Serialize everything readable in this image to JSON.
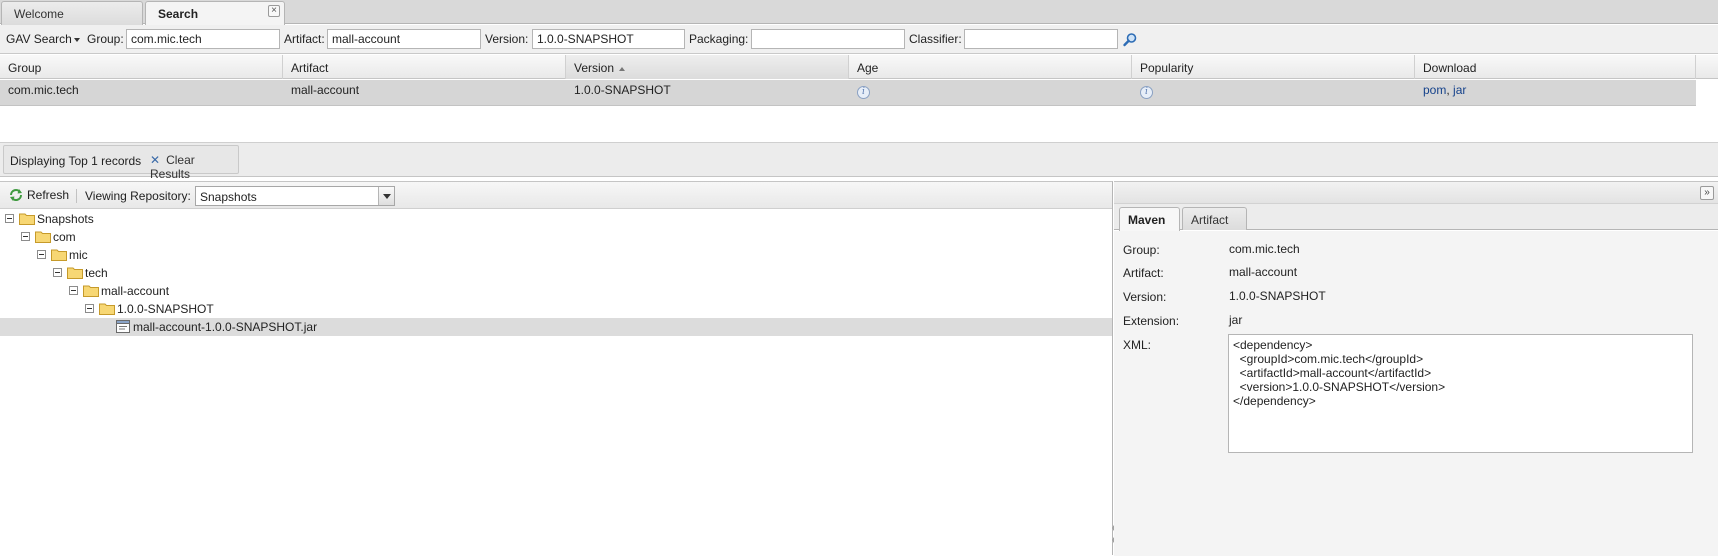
{
  "tabs": [
    {
      "label": "Welcome"
    },
    {
      "label": "Search"
    }
  ],
  "search": {
    "mode_label": "GAV Search",
    "group_label": "Group:",
    "group_value": "com.mic.tech",
    "artifact_label": "Artifact:",
    "artifact_value": "mall-account",
    "version_label": "Version:",
    "version_value": "1.0.0-SNAPSHOT",
    "packaging_label": "Packaging:",
    "packaging_value": "",
    "classifier_label": "Classifier:",
    "classifier_value": ""
  },
  "results": {
    "columns": [
      "Group",
      "Artifact",
      "Version",
      "Age",
      "Popularity",
      "Download"
    ],
    "sorted_column": "Version",
    "rows": [
      {
        "group": "com.mic.tech",
        "artifact": "mall-account",
        "version": "1.0.0-SNAPSHOT",
        "download_pom": "pom",
        "download_sep": ",",
        "download_jar": "jar"
      }
    ]
  },
  "status": {
    "text": "Displaying Top 1 records",
    "clear_label": "Clear Results"
  },
  "browser": {
    "refresh_label": "Refresh",
    "viewing_label": "Viewing Repository:",
    "repository_value": "Snapshots",
    "tree": [
      {
        "label": "Snapshots",
        "depth": 0,
        "type": "folder"
      },
      {
        "label": "com",
        "depth": 1,
        "type": "folder"
      },
      {
        "label": "mic",
        "depth": 2,
        "type": "folder"
      },
      {
        "label": "tech",
        "depth": 3,
        "type": "folder"
      },
      {
        "label": "mall-account",
        "depth": 4,
        "type": "folder"
      },
      {
        "label": "1.0.0-SNAPSHOT",
        "depth": 5,
        "type": "folder"
      },
      {
        "label": "mall-account-1.0.0-SNAPSHOT.jar",
        "depth": 6,
        "type": "file",
        "selected": true
      }
    ]
  },
  "details": {
    "tabs": [
      {
        "label": "Maven"
      },
      {
        "label": "Artifact"
      }
    ],
    "group_label": "Group:",
    "group_value": "com.mic.tech",
    "artifact_label": "Artifact:",
    "artifact_value": "mall-account",
    "version_label": "Version:",
    "version_value": "1.0.0-SNAPSHOT",
    "extension_label": "Extension:",
    "extension_value": "jar",
    "xml_label": "XML:",
    "xml_value": "<dependency>\n  <groupId>com.mic.tech</groupId>\n  <artifactId>mall-account</artifactId>\n  <version>1.0.0-SNAPSHOT</version>\n</dependency>"
  },
  "colors": {
    "link": "#15428b",
    "folder": "#f2c94c",
    "selected_row": "#d6d6d6"
  },
  "icons": {
    "search": "magnifier-icon",
    "refresh": "refresh-icon",
    "folder": "folder-icon",
    "file": "jar-file-icon",
    "info": "info-icon",
    "collapse": "double-chevron-right-icon"
  }
}
